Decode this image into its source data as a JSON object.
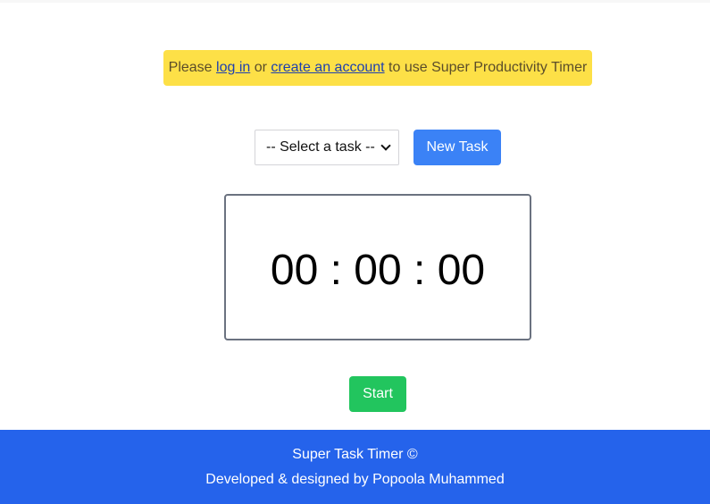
{
  "alert": {
    "prefix": "Please ",
    "login_link": "log in",
    "middle": " or ",
    "signup_link": "create an account",
    "suffix": " to use Super Productivity Timer"
  },
  "task_select": {
    "selected": "-- Select a task --"
  },
  "new_task_button": "New Task",
  "timer": {
    "hours": "00",
    "minutes": "00",
    "seconds": "00",
    "separator": " : "
  },
  "start_button": "Start",
  "footer": {
    "line1": "Super Task Timer ©",
    "line2": "Developed & designed by Popoola Muhammed"
  },
  "colors": {
    "alert_bg": "#fde047",
    "new_task_bg": "#3b82f6",
    "start_bg": "#22c55e",
    "footer_bg": "#2563eb"
  }
}
